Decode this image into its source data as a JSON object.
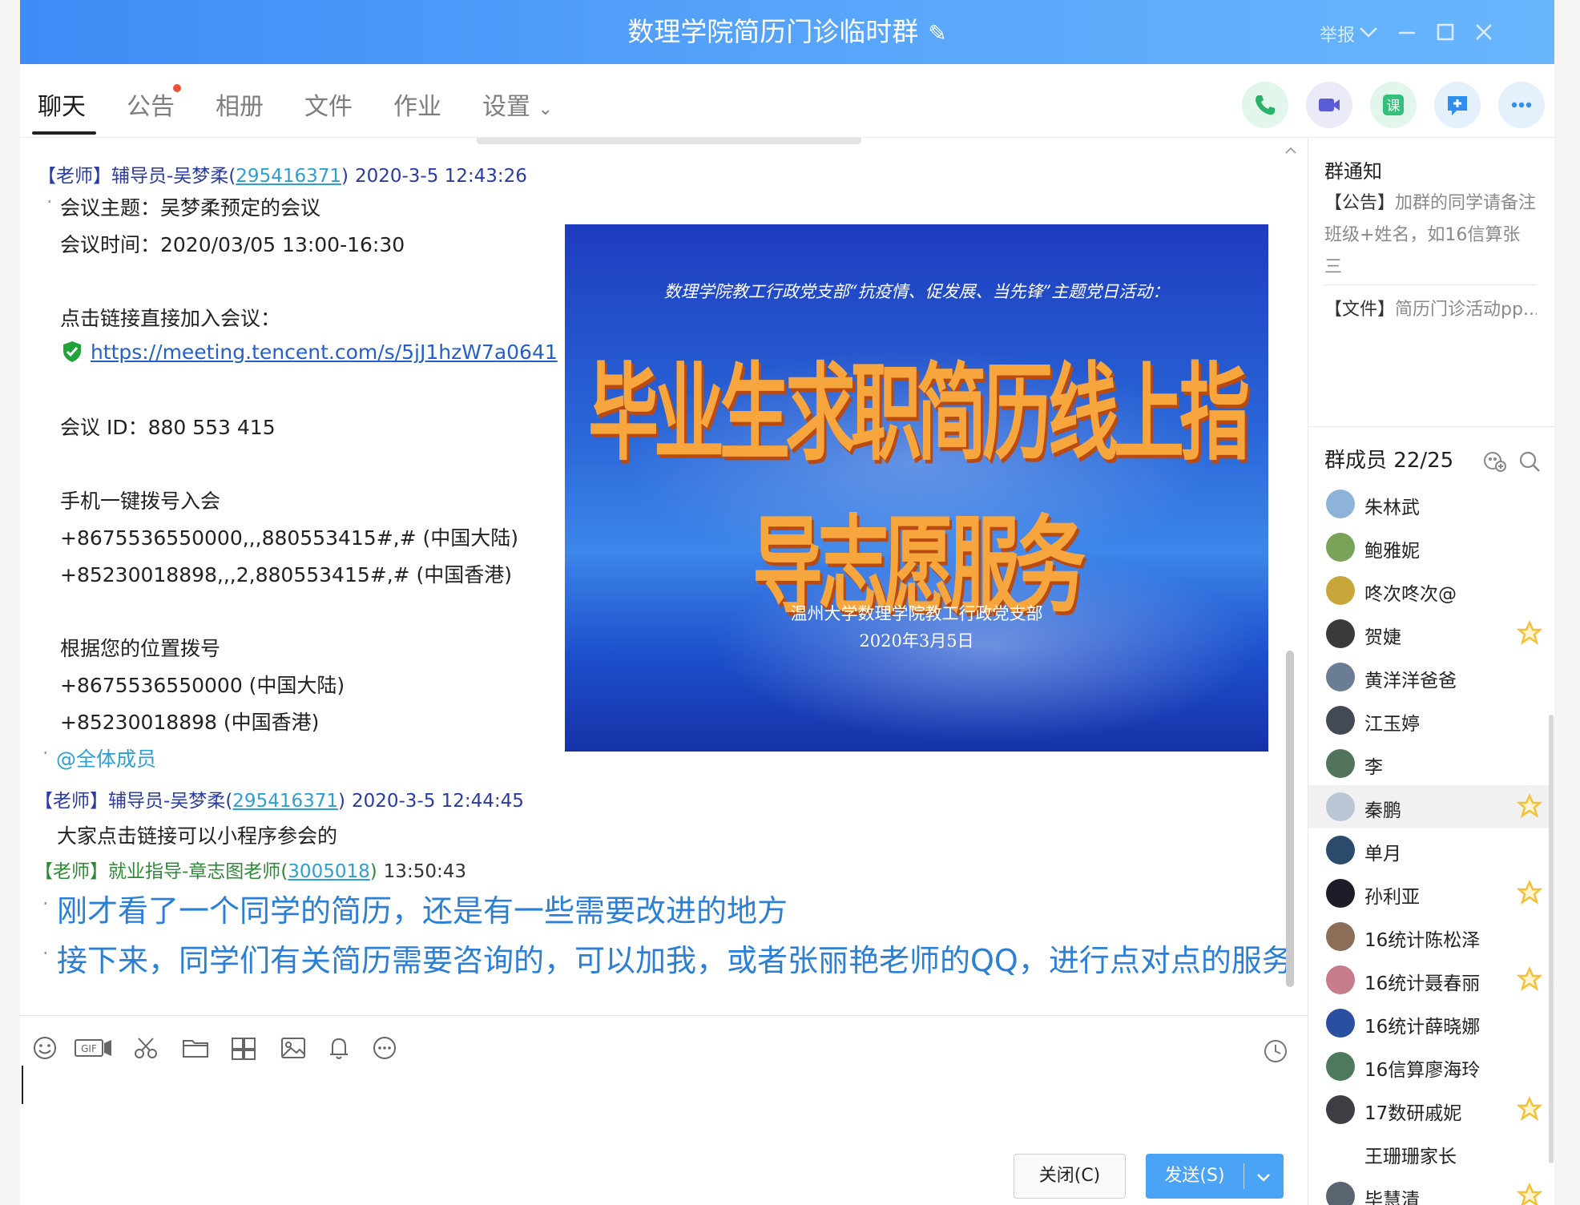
{
  "window": {
    "title": "数理学院简历门诊临时群",
    "report_label": "举报"
  },
  "tabs": [
    {
      "label": "聊天",
      "active": true
    },
    {
      "label": "公告",
      "has_dot": true
    },
    {
      "label": "相册"
    },
    {
      "label": "文件"
    },
    {
      "label": "作业"
    },
    {
      "label": "设置"
    }
  ],
  "chat": {
    "msg1": {
      "sender": "【老师】辅导员-吴梦柔",
      "qq_open": "(",
      "qq": "295416371",
      "qq_close": ")",
      "time": "2020-3-5 12:43:26",
      "lines": [
        "会议主题：吴梦柔预定的会议",
        "会议时间：2020/03/05 13:00-16:30",
        "点击链接直接加入会议：",
        "https://meeting.tencent.com/s/5jJ1hzW7a0641",
        "会议 ID：880 553 415",
        "手机一键拨号入会",
        "+8675536550000,,,880553415#,# (中国大陆)",
        "+85230018898,,,2,880553415#,# (中国香港)",
        "根据您的位置拨号",
        "+8675536550000 (中国大陆)",
        "+85230018898 (中国香港)",
        "@全体成员"
      ]
    },
    "msg2": {
      "sender": "【老师】辅导员-吴梦柔",
      "qq_open": "(",
      "qq": "295416371",
      "qq_close": ")",
      "time": "2020-3-5 12:44:45",
      "text": "大家点击链接可以小程序参会的"
    },
    "msg3": {
      "sender": "【老师】就业指导-章志图老师",
      "qq_open": "(",
      "qq": "3005018",
      "qq_close": ")",
      "time": "13:50:43",
      "lines": [
        "刚才看了一个同学的简历，还是有一些需要改进的地方",
        "接下来，同学们有关简历需要咨询的，可以加我，或者张丽艳老师的QQ，进行点对点的服务"
      ]
    },
    "slide": {
      "subtitle": "数理学院教工行政党支部“抗疫情、促发展、当先锋”主题党日活动：",
      "headline": "毕业生求职简历线上指导志愿服务",
      "org": "温州大学数理学院教工行政党支部",
      "date": "2020年3月5日"
    }
  },
  "side": {
    "notice_title": "群通知",
    "notice_tag": "【公告】",
    "notice_text": "加群的同学请备注班级+姓名，如16信算张三",
    "file_tag": "【文件】",
    "file_text": "简历门诊活动pp...",
    "members_label": "群成员",
    "members_count": "22/25",
    "members": [
      {
        "name": "朱林武",
        "star": false,
        "color": "#8db3d8"
      },
      {
        "name": "鲍雅妮",
        "star": false,
        "color": "#7aa35a"
      },
      {
        "name": "咚次咚次@",
        "star": false,
        "color": "#c9a63a"
      },
      {
        "name": "贺婕",
        "star": true,
        "color": "#3a3a3a"
      },
      {
        "name": "黄洋洋爸爸",
        "star": false,
        "color": "#6b7d95"
      },
      {
        "name": "江玉婷",
        "star": false,
        "color": "#444a55"
      },
      {
        "name": "李",
        "star": false,
        "color": "#52735c"
      },
      {
        "name": "秦鹏",
        "star": true,
        "color": "#b9c6d3",
        "highlight": true
      },
      {
        "name": "单月",
        "star": false,
        "color": "#2c4a6b"
      },
      {
        "name": "孙利亚",
        "star": true,
        "color": "#1d1d2a"
      },
      {
        "name": "16统计陈松泽",
        "star": false,
        "color": "#8c6d58"
      },
      {
        "name": "16统计聂春丽",
        "star": true,
        "color": "#c67c8a"
      },
      {
        "name": "16统计薛晓娜",
        "star": false,
        "color": "#2a4fa0"
      },
      {
        "name": "16信算廖海玲",
        "star": false,
        "color": "#4d7a5a"
      },
      {
        "name": "17数研戚妮",
        "star": true,
        "color": "#3d3d44"
      },
      {
        "name": "王珊珊家长",
        "star": false,
        "color": "#ffffff"
      },
      {
        "name": "毕慧清",
        "star": true,
        "color": "#5a6470"
      }
    ]
  },
  "input": {
    "close_label": "关闭(C)",
    "send_label": "发送(S)"
  },
  "colors": {
    "titlebar": "#4a98f8",
    "sender": "#2a3ba3",
    "qq_link": "#2d9fd1",
    "teacher_green": "#2f8a36",
    "message_blue": "#2b7fd4",
    "send_button": "#4aa3f4",
    "star": "#f5c033"
  }
}
